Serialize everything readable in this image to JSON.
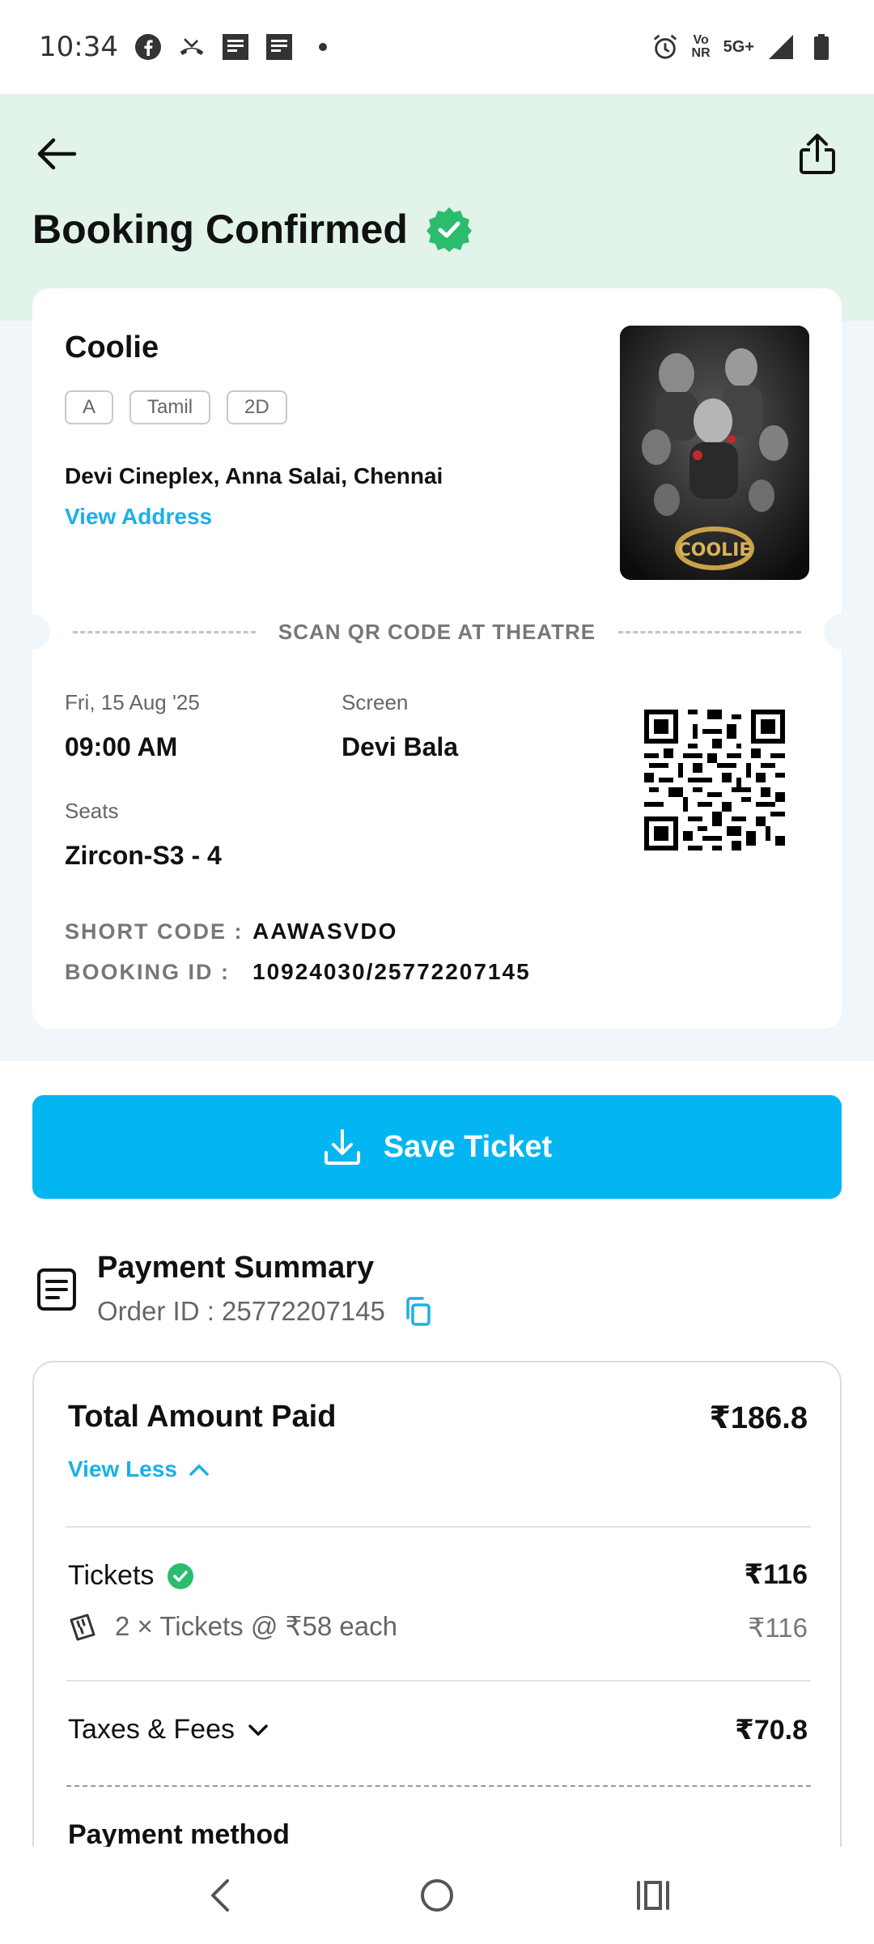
{
  "status_bar": {
    "time": "10:34",
    "left_icons": [
      "facebook-icon",
      "missed-call-icon",
      "news-icon",
      "news-icon",
      "dot-icon"
    ],
    "network_top": "Vo",
    "network_bottom": "NR",
    "network_type": "5G+",
    "right_icons": [
      "alarm-icon",
      "volte-icon",
      "5g-icon",
      "signal-icon",
      "battery-icon"
    ]
  },
  "header": {
    "title": "Booking Confirmed",
    "back_icon": "back-arrow-icon",
    "share_icon": "share-icon",
    "verified_icon": "verified-badge-icon"
  },
  "ticket": {
    "movie_title": "Coolie",
    "tags": [
      "A",
      "Tamil",
      "2D"
    ],
    "venue": "Devi Cineplex, Anna Salai, Chennai",
    "view_address": "View Address",
    "poster_caption": "COOLIE",
    "scan_label": "SCAN QR CODE AT THEATRE",
    "date_label": "Fri, 15 Aug '25",
    "time_value": "09:00 AM",
    "screen_label": "Screen",
    "screen_value": "Devi Bala",
    "seats_label": "Seats",
    "seats_value": "Zircon-S3 - 4",
    "short_code_label": "SHORT CODE :",
    "short_code_value": "AAWASVDO",
    "booking_id_label": "BOOKING ID :",
    "booking_id_value": "10924030/25772207145"
  },
  "save_button": {
    "label": "Save Ticket",
    "icon": "download-icon"
  },
  "payment": {
    "title": "Payment Summary",
    "order_id": "Order ID : 25772207145",
    "total_label": "Total Amount Paid",
    "total_value": "₹186.8",
    "view_less": "View Less",
    "tickets_label": "Tickets",
    "tickets_value": "₹116",
    "tickets_detail": "2 × Tickets @ ₹58 each",
    "tickets_detail_value": "₹116",
    "taxes_label": "Taxes & Fees",
    "taxes_value": "₹70.8",
    "payment_method_label": "Payment method"
  },
  "colors": {
    "accent": "#03b6f2",
    "link": "#1ab0e8",
    "header_bg": "#e2f4ea",
    "success": "#2bbd6e"
  },
  "nav": {
    "icons": [
      "nav-back-icon",
      "nav-home-icon",
      "nav-recents-icon"
    ]
  }
}
